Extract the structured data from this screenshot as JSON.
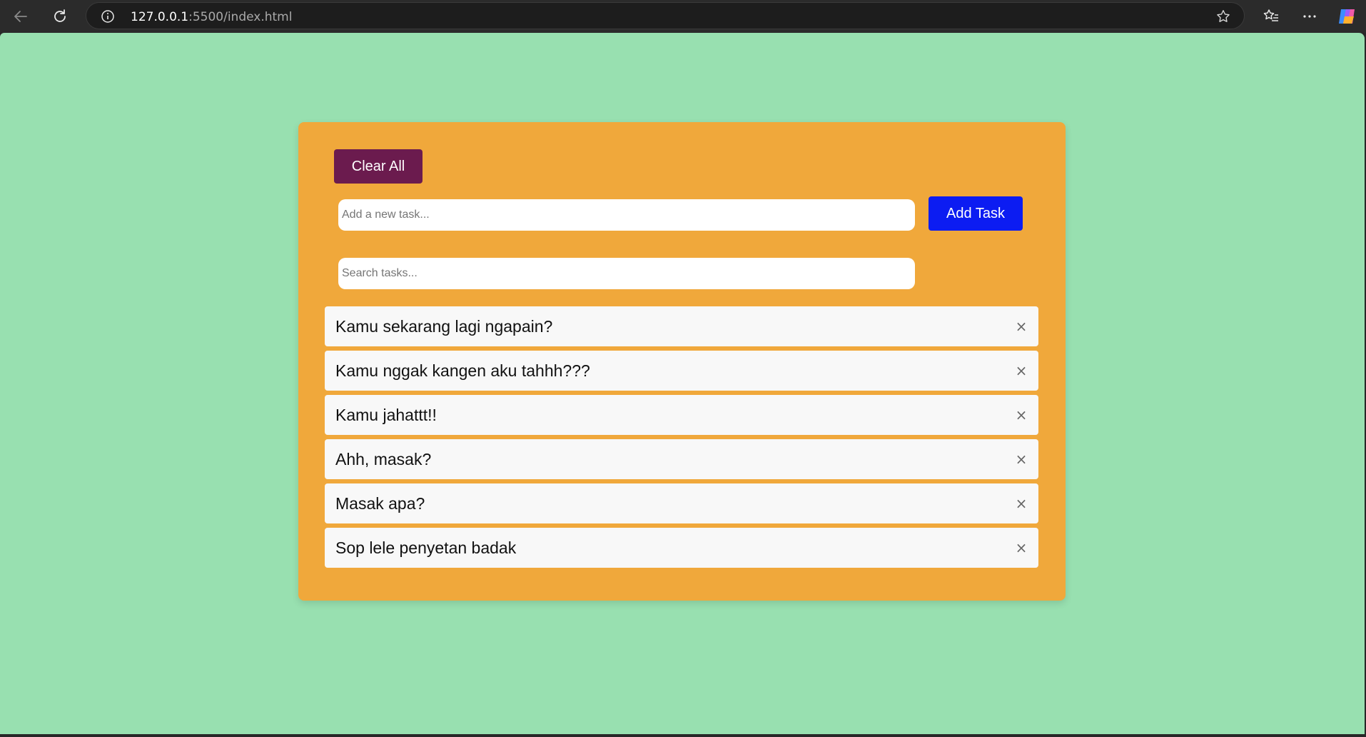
{
  "browser": {
    "address_host": "127.0.0.1",
    "address_path": ":5500/index.html",
    "icons": {
      "back": "back-arrow-icon",
      "reload": "reload-icon",
      "info": "info-icon",
      "star": "star-icon",
      "favorites": "favorites-icon",
      "more": "more-icon",
      "copilot": "copilot-icon"
    }
  },
  "colors": {
    "page_background": "#98e0b0",
    "card_background": "#f0a83b",
    "clear_button": "#6b1b4e",
    "add_button": "#0c1cf2",
    "task_background": "#f8f8f8"
  },
  "app": {
    "clear_all_label": "Clear All",
    "task_input": {
      "placeholder": "Add a new task...",
      "value": ""
    },
    "add_task_label": "Add Task",
    "search_input": {
      "placeholder": "Search tasks...",
      "value": ""
    },
    "delete_symbol": "×",
    "tasks": [
      {
        "text": "Kamu sekarang lagi ngapain?"
      },
      {
        "text": "Kamu nggak kangen aku tahhh???"
      },
      {
        "text": "Kamu jahattt!!"
      },
      {
        "text": "Ahh, masak?"
      },
      {
        "text": "Masak apa?"
      },
      {
        "text": "Sop lele penyetan badak"
      }
    ]
  }
}
